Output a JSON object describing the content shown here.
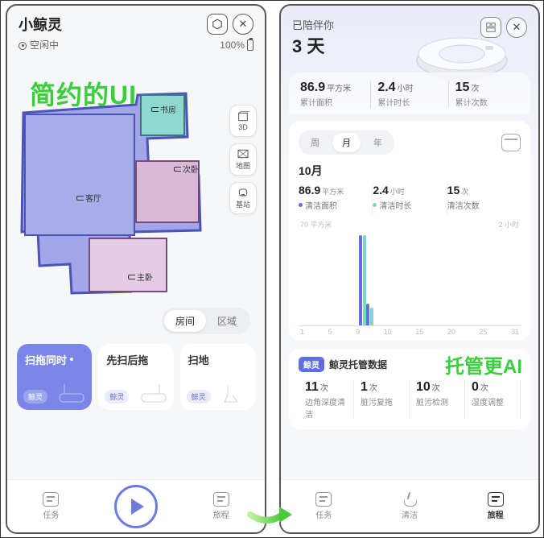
{
  "overlays": {
    "left": "简约的UI",
    "right": "托管更AI"
  },
  "left": {
    "title": "小鲸灵",
    "status_text": "空闲中",
    "battery_pct": "100%",
    "rooms": {
      "study": "书房",
      "second": "次卧",
      "living": "客厅",
      "master": "主卧"
    },
    "tools": {
      "view3d": "3D",
      "map": "地图",
      "base": "基站"
    },
    "segmented": {
      "room": "房间",
      "area": "区域"
    },
    "modes": {
      "a": {
        "title": "扫拖同时",
        "tag": "鲸灵"
      },
      "b": {
        "title": "先扫后拖",
        "tag": "鲸灵"
      },
      "c": {
        "title": "扫地",
        "tag": "鲸灵"
      }
    },
    "nav": {
      "tasks": "任务",
      "journey": "旅程"
    }
  },
  "right": {
    "header": {
      "sub": "已陪伴你",
      "big": "3 天"
    },
    "summary": {
      "area": {
        "value": "86.9",
        "unit": "平方米",
        "label": "累计面积"
      },
      "time": {
        "value": "2.4",
        "unit": "小时",
        "label": "累计时长"
      },
      "count": {
        "value": "15",
        "unit": "次",
        "label": "累计次数"
      }
    },
    "tabs": {
      "week": "周",
      "month": "月",
      "year": "年"
    },
    "month_label": "10月",
    "legend": {
      "area": {
        "value": "86.9",
        "unit": "平方米",
        "label": "清洁面积",
        "color": "#5f6fe0"
      },
      "time": {
        "value": "2.4",
        "unit": "小时",
        "label": "清洁时长",
        "color": "#7fd6c8"
      },
      "count": {
        "value": "15",
        "unit": "次",
        "label": "清洁次数"
      }
    },
    "axis": {
      "ytop_left": "70 平方米",
      "ytop_right": "2 小时"
    },
    "mgmt": {
      "badge": "鲸灵",
      "title": "鲸灵托管数据",
      "stats": {
        "a": {
          "value": "11",
          "unit": "次",
          "label": "边角深度清洁"
        },
        "b": {
          "value": "1",
          "unit": "次",
          "label": "脏污复拖"
        },
        "c": {
          "value": "10",
          "unit": "次",
          "label": "脏污检测"
        },
        "d": {
          "value": "0",
          "unit": "次",
          "label": "湿度调整"
        }
      }
    },
    "nav": {
      "tasks": "任务",
      "clean": "清洁",
      "journey": "旅程"
    }
  },
  "chart_data": {
    "type": "bar",
    "title": "10月",
    "x": [
      1,
      5,
      9,
      10,
      15,
      20,
      25,
      31
    ],
    "area_series": {
      "name": "清洁面积",
      "unit": "平方米",
      "color": "#5f6fe0",
      "points": {
        "9": 70,
        "10": 16.9
      }
    },
    "time_series": {
      "name": "清洁时长",
      "unit": "小时",
      "color": "#7fd6c8",
      "points": {
        "9": 2.0,
        "10": 0.4
      }
    },
    "y_left_max": 70,
    "y_right_max": 2,
    "xlabel": "",
    "ylabel": ""
  }
}
